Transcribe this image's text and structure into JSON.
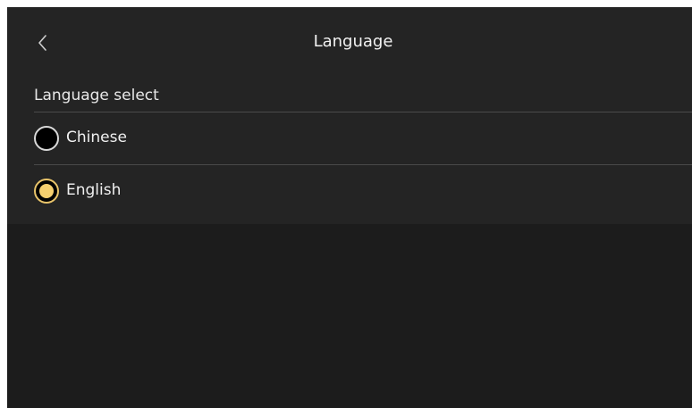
{
  "header": {
    "title": "Language",
    "back_icon": "chevron-left-icon"
  },
  "section": {
    "label": "Language select"
  },
  "options": [
    {
      "label": "Chinese",
      "selected": false
    },
    {
      "label": "English",
      "selected": true
    }
  ],
  "colors": {
    "background": "#1c1c1c",
    "panel": "#242424",
    "accent": "#f5cf6e",
    "text": "#f0f0f0",
    "divider": "#4a4a4a"
  }
}
